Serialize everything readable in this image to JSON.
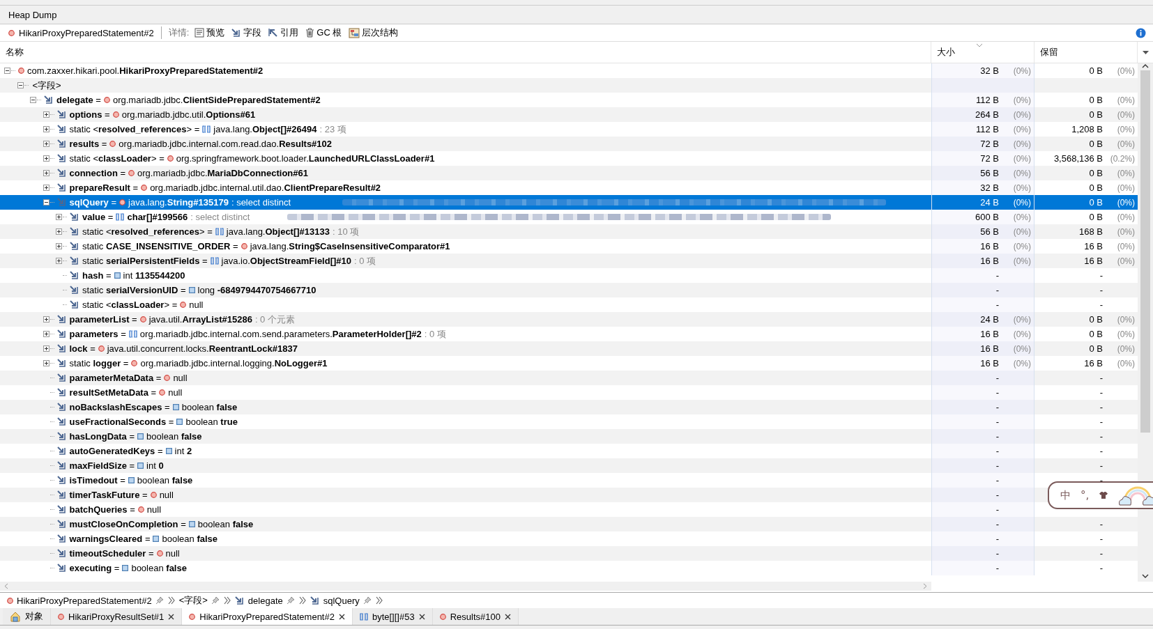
{
  "window_tab": {
    "label": "Heap Dump",
    "selected": true
  },
  "toolbar": {
    "object": "HikariProxyPreparedStatement#2",
    "details_label": "详情:",
    "buttons": [
      "预览",
      "字段",
      "引用",
      "GC 根",
      "层次结构"
    ]
  },
  "columns": [
    {
      "label": "名称",
      "sorted": false
    },
    {
      "label": "大小",
      "sorted": true
    },
    {
      "label": "保留",
      "sorted": false
    }
  ],
  "tree": [
    {
      "kind": "object",
      "label": "com.zaxxer.hikari.pool.**HikariProxyPreparedStatement#2**",
      "size": "32 B",
      "size_pct": "(0%)",
      "retained": "0 B",
      "retained_pct": "(0%)",
      "selected": false,
      "expanded": true,
      "children": [
        {
          "kind": "group",
          "label": "<字段>",
          "selected": false,
          "expanded": true,
          "children": [
            {
              "kind": "field",
              "label": "**delegate** =",
              "value": {
                "kind": "object",
                "text": "org.mariadb.jdbc.**ClientSidePreparedStatement#2**"
              },
              "size": "112 B",
              "size_pct": "(0%)",
              "retained": "0 B",
              "retained_pct": "(0%)",
              "selected": false,
              "expanded": true,
              "children": [
                {
                  "kind": "field",
                  "label": "**options** =",
                  "value": {
                    "kind": "object",
                    "text": "org.mariadb.jdbc.util.**Options#61**"
                  },
                  "size": "264 B",
                  "size_pct": "(0%)",
                  "retained": "0 B",
                  "retained_pct": "(0%)",
                  "selected": false,
                  "expanded": false
                },
                {
                  "kind": "field",
                  "label": "static <**resolved_references**> =",
                  "value": {
                    "kind": "array",
                    "text": "java.lang.**Object[]#26494**"
                  },
                  "note": ": 23 项",
                  "size": "112 B",
                  "size_pct": "(0%)",
                  "retained": "1,208 B",
                  "retained_pct": "(0%)",
                  "selected": false,
                  "expanded": false
                },
                {
                  "kind": "field",
                  "label": "**results** =",
                  "value": {
                    "kind": "object",
                    "text": "org.mariadb.jdbc.internal.com.read.dao.**Results#102**"
                  },
                  "size": "72 B",
                  "size_pct": "(0%)",
                  "retained": "0 B",
                  "retained_pct": "(0%)",
                  "selected": false,
                  "expanded": false
                },
                {
                  "kind": "field",
                  "label": "static <**classLoader**> =",
                  "value": {
                    "kind": "object",
                    "text": "org.springframework.boot.loader.**LaunchedURLClassLoader#1**"
                  },
                  "size": "72 B",
                  "size_pct": "(0%)",
                  "retained": "3,568,136 B",
                  "retained_pct": "(0.2%)",
                  "selected": false,
                  "expanded": false
                },
                {
                  "kind": "field",
                  "label": "**connection** =",
                  "value": {
                    "kind": "object",
                    "text": "org.mariadb.jdbc.**MariaDbConnection#61**"
                  },
                  "size": "56 B",
                  "size_pct": "(0%)",
                  "retained": "0 B",
                  "retained_pct": "(0%)",
                  "selected": false,
                  "expanded": false
                },
                {
                  "kind": "field",
                  "label": "**prepareResult** =",
                  "value": {
                    "kind": "object",
                    "text": "org.mariadb.jdbc.internal.util.dao.**ClientPrepareResult#2**"
                  },
                  "size": "32 B",
                  "size_pct": "(0%)",
                  "retained": "0 B",
                  "retained_pct": "(0%)",
                  "selected": false,
                  "expanded": false
                },
                {
                  "kind": "field",
                  "label": "**sqlQuery** =",
                  "value": {
                    "kind": "object",
                    "text": "java.lang.**String#135179**"
                  },
                  "note": ": select distinct",
                  "redacted": true,
                  "size": "24 B",
                  "size_pct": "(0%)",
                  "retained": "0 B",
                  "retained_pct": "(0%)",
                  "selected": true,
                  "expanded": true,
                  "children": [
                    {
                      "kind": "field",
                      "label": "**value** =",
                      "value": {
                        "kind": "array",
                        "text": "**char[]#199566**"
                      },
                      "note": ": select distinct",
                      "redacted": true,
                      "size": "600 B",
                      "size_pct": "(0%)",
                      "retained": "0 B",
                      "retained_pct": "(0%)",
                      "selected": false,
                      "expanded": false
                    },
                    {
                      "kind": "field",
                      "label": "static <**resolved_references**> =",
                      "value": {
                        "kind": "array",
                        "text": "java.lang.**Object[]#13133**"
                      },
                      "note": ": 10 项",
                      "size": "56 B",
                      "size_pct": "(0%)",
                      "retained": "168 B",
                      "retained_pct": "(0%)",
                      "selected": false,
                      "expanded": false
                    },
                    {
                      "kind": "field",
                      "label": "static **CASE_INSENSITIVE_ORDER** =",
                      "value": {
                        "kind": "object",
                        "text": "java.lang.**String$CaseInsensitiveComparator#1**"
                      },
                      "size": "16 B",
                      "size_pct": "(0%)",
                      "retained": "16 B",
                      "retained_pct": "(0%)",
                      "selected": false,
                      "expanded": false
                    },
                    {
                      "kind": "field",
                      "label": "static **serialPersistentFields** =",
                      "value": {
                        "kind": "array",
                        "text": "java.io.**ObjectStreamField[]#10**"
                      },
                      "note": ": 0 项",
                      "size": "16 B",
                      "size_pct": "(0%)",
                      "retained": "16 B",
                      "retained_pct": "(0%)",
                      "selected": false,
                      "expanded": false
                    },
                    {
                      "kind": "field",
                      "label": "**hash** =",
                      "value": {
                        "kind": "primitive",
                        "text": "int **1135544200**"
                      },
                      "size": "-",
                      "retained": "-",
                      "selected": false
                    },
                    {
                      "kind": "field",
                      "label": "static **serialVersionUID** =",
                      "value": {
                        "kind": "primitive",
                        "text": "long **-6849794470754667710**"
                      },
                      "size": "-",
                      "retained": "-",
                      "selected": false
                    },
                    {
                      "kind": "field",
                      "label": "static <**classLoader**> =",
                      "value": {
                        "kind": "object",
                        "text": "null"
                      },
                      "size": "-",
                      "retained": "-",
                      "selected": false
                    }
                  ]
                },
                {
                  "kind": "field",
                  "label": "**parameterList** =",
                  "value": {
                    "kind": "object",
                    "text": "java.util.**ArrayList#15286**"
                  },
                  "note": ": 0 个元素",
                  "size": "24 B",
                  "size_pct": "(0%)",
                  "retained": "0 B",
                  "retained_pct": "(0%)",
                  "selected": false,
                  "expanded": false
                },
                {
                  "kind": "field",
                  "label": "**parameters** =",
                  "value": {
                    "kind": "array",
                    "text": "org.mariadb.jdbc.internal.com.send.parameters.**ParameterHolder[]#2**"
                  },
                  "note": ": 0 项",
                  "size": "16 B",
                  "size_pct": "(0%)",
                  "retained": "0 B",
                  "retained_pct": "(0%)",
                  "selected": false,
                  "expanded": false
                },
                {
                  "kind": "field",
                  "label": "**lock** =",
                  "value": {
                    "kind": "object",
                    "text": "java.util.concurrent.locks.**ReentrantLock#1837**"
                  },
                  "size": "16 B",
                  "size_pct": "(0%)",
                  "retained": "0 B",
                  "retained_pct": "(0%)",
                  "selected": false,
                  "expanded": false
                },
                {
                  "kind": "field",
                  "label": "static **logger** =",
                  "value": {
                    "kind": "object",
                    "text": "org.mariadb.jdbc.internal.logging.**NoLogger#1**"
                  },
                  "size": "16 B",
                  "size_pct": "(0%)",
                  "retained": "16 B",
                  "retained_pct": "(0%)",
                  "selected": false,
                  "expanded": false
                },
                {
                  "kind": "field",
                  "label": "**parameterMetaData** =",
                  "value": {
                    "kind": "object",
                    "text": "null"
                  },
                  "size": "-",
                  "retained": "-",
                  "selected": false
                },
                {
                  "kind": "field",
                  "label": "**resultSetMetaData** =",
                  "value": {
                    "kind": "object",
                    "text": "null"
                  },
                  "size": "-",
                  "retained": "-",
                  "selected": false
                },
                {
                  "kind": "field",
                  "label": "**noBackslashEscapes** =",
                  "value": {
                    "kind": "primitive",
                    "text": "boolean **false**"
                  },
                  "size": "-",
                  "retained": "-",
                  "selected": false
                },
                {
                  "kind": "field",
                  "label": "**useFractionalSeconds** =",
                  "value": {
                    "kind": "primitive",
                    "text": "boolean **true**"
                  },
                  "size": "-",
                  "retained": "-",
                  "selected": false
                },
                {
                  "kind": "field",
                  "label": "**hasLongData** =",
                  "value": {
                    "kind": "primitive",
                    "text": "boolean **false**"
                  },
                  "size": "-",
                  "retained": "-",
                  "selected": false
                },
                {
                  "kind": "field",
                  "label": "**autoGeneratedKeys** =",
                  "value": {
                    "kind": "primitive",
                    "text": "int **2**"
                  },
                  "size": "-",
                  "retained": "-",
                  "selected": false
                },
                {
                  "kind": "field",
                  "label": "**maxFieldSize** =",
                  "value": {
                    "kind": "primitive",
                    "text": "int **0**"
                  },
                  "size": "-",
                  "retained": "-",
                  "selected": false
                },
                {
                  "kind": "field",
                  "label": "**isTimedout** =",
                  "value": {
                    "kind": "primitive",
                    "text": "boolean **false**"
                  },
                  "size": "-",
                  "retained": "-",
                  "selected": false
                },
                {
                  "kind": "field",
                  "label": "**timerTaskFuture** =",
                  "value": {
                    "kind": "object",
                    "text": "null"
                  },
                  "size": "-",
                  "selected": false
                },
                {
                  "kind": "field",
                  "label": "**batchQueries** =",
                  "value": {
                    "kind": "object",
                    "text": "null"
                  },
                  "size": "-",
                  "selected": false
                },
                {
                  "kind": "field",
                  "label": "**mustCloseOnCompletion** =",
                  "value": {
                    "kind": "primitive",
                    "text": "boolean **false**"
                  },
                  "size": "-",
                  "retained": "-",
                  "selected": false
                },
                {
                  "kind": "field",
                  "label": "**warningsCleared** =",
                  "value": {
                    "kind": "primitive",
                    "text": "boolean **false**"
                  },
                  "size": "-",
                  "retained": "-",
                  "selected": false
                },
                {
                  "kind": "field",
                  "label": "**timeoutScheduler** =",
                  "value": {
                    "kind": "object",
                    "text": "null"
                  },
                  "size": "-",
                  "retained": "-",
                  "selected": false
                },
                {
                  "kind": "field",
                  "label": "**executing** =",
                  "value": {
                    "kind": "primitive",
                    "text": "boolean **false**"
                  },
                  "size": "-",
                  "retained": "-",
                  "selected": false
                }
              ]
            }
          ]
        }
      ]
    }
  ],
  "breadcrumb": [
    {
      "label": "HikariProxyPreparedStatement#2",
      "kind": "object"
    },
    {
      "label": "<字段>",
      "kind": "group"
    },
    {
      "label": "delegate",
      "kind": "field"
    },
    {
      "label": "sqlQuery",
      "kind": "field"
    }
  ],
  "tabs": [
    {
      "label": "对象",
      "kind": "home",
      "selected": false,
      "closable": false
    },
    {
      "label": "HikariProxyResultSet#1",
      "kind": "object",
      "selected": false,
      "closable": true
    },
    {
      "label": "HikariProxyPreparedStatement#2",
      "kind": "object",
      "selected": true,
      "closable": true
    },
    {
      "label": "byte[][]#53",
      "kind": "array",
      "selected": false,
      "closable": true
    },
    {
      "label": "Results#100",
      "kind": "object",
      "selected": false,
      "closable": true
    }
  ],
  "ime_bar": {
    "mode": "中",
    "punct": "°,"
  }
}
